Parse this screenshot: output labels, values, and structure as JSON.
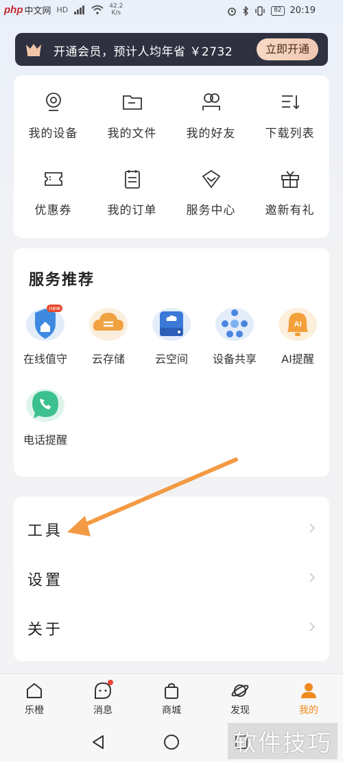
{
  "status_bar": {
    "logo": "php",
    "logo_cn": "中文网",
    "sig": "HD",
    "speed_value": "42.2",
    "speed_unit": "K/s",
    "time": "20:19",
    "battery": "82"
  },
  "vip": {
    "text": "开通会员，预计人均年省 ￥2732",
    "button": "立即开通"
  },
  "grid": {
    "items": [
      {
        "label": "我的设备",
        "icon": "camera-icon"
      },
      {
        "label": "我的文件",
        "icon": "folder-icon"
      },
      {
        "label": "我的好友",
        "icon": "friends-icon"
      },
      {
        "label": "下载列表",
        "icon": "download-list-icon"
      },
      {
        "label": "优惠券",
        "icon": "coupon-icon"
      },
      {
        "label": "我的订单",
        "icon": "order-icon"
      },
      {
        "label": "服务中心",
        "icon": "service-icon"
      },
      {
        "label": "邀新有礼",
        "icon": "gift-icon"
      }
    ]
  },
  "services": {
    "title": "服务推荐",
    "badge": "new",
    "items": [
      {
        "label": "在线值守",
        "icon": "shield-home-icon",
        "color": "#3f8ae0"
      },
      {
        "label": "云存储",
        "icon": "cloud-storage-icon",
        "color": "#f0a243"
      },
      {
        "label": "云空间",
        "icon": "cloud-disk-icon",
        "color": "#3b78d8"
      },
      {
        "label": "设备共享",
        "icon": "share-nodes-icon",
        "color": "#4a86e0"
      },
      {
        "label": "AI提醒",
        "icon": "ai-bell-icon",
        "color": "#f4a03a"
      },
      {
        "label": "电话提醒",
        "icon": "phone-icon",
        "color": "#3cc08e"
      }
    ]
  },
  "menu": {
    "items": [
      {
        "label": "工具"
      },
      {
        "label": "设置"
      },
      {
        "label": "关于"
      }
    ]
  },
  "tabbar": {
    "tabs": [
      {
        "label": "乐橙",
        "icon": "home-icon"
      },
      {
        "label": "消息",
        "icon": "message-icon"
      },
      {
        "label": "商城",
        "icon": "bag-icon"
      },
      {
        "label": "发现",
        "icon": "planet-icon"
      },
      {
        "label": "我的",
        "icon": "profile-icon"
      }
    ],
    "active_color": "#f08a1e"
  },
  "watermark": "软件技巧"
}
